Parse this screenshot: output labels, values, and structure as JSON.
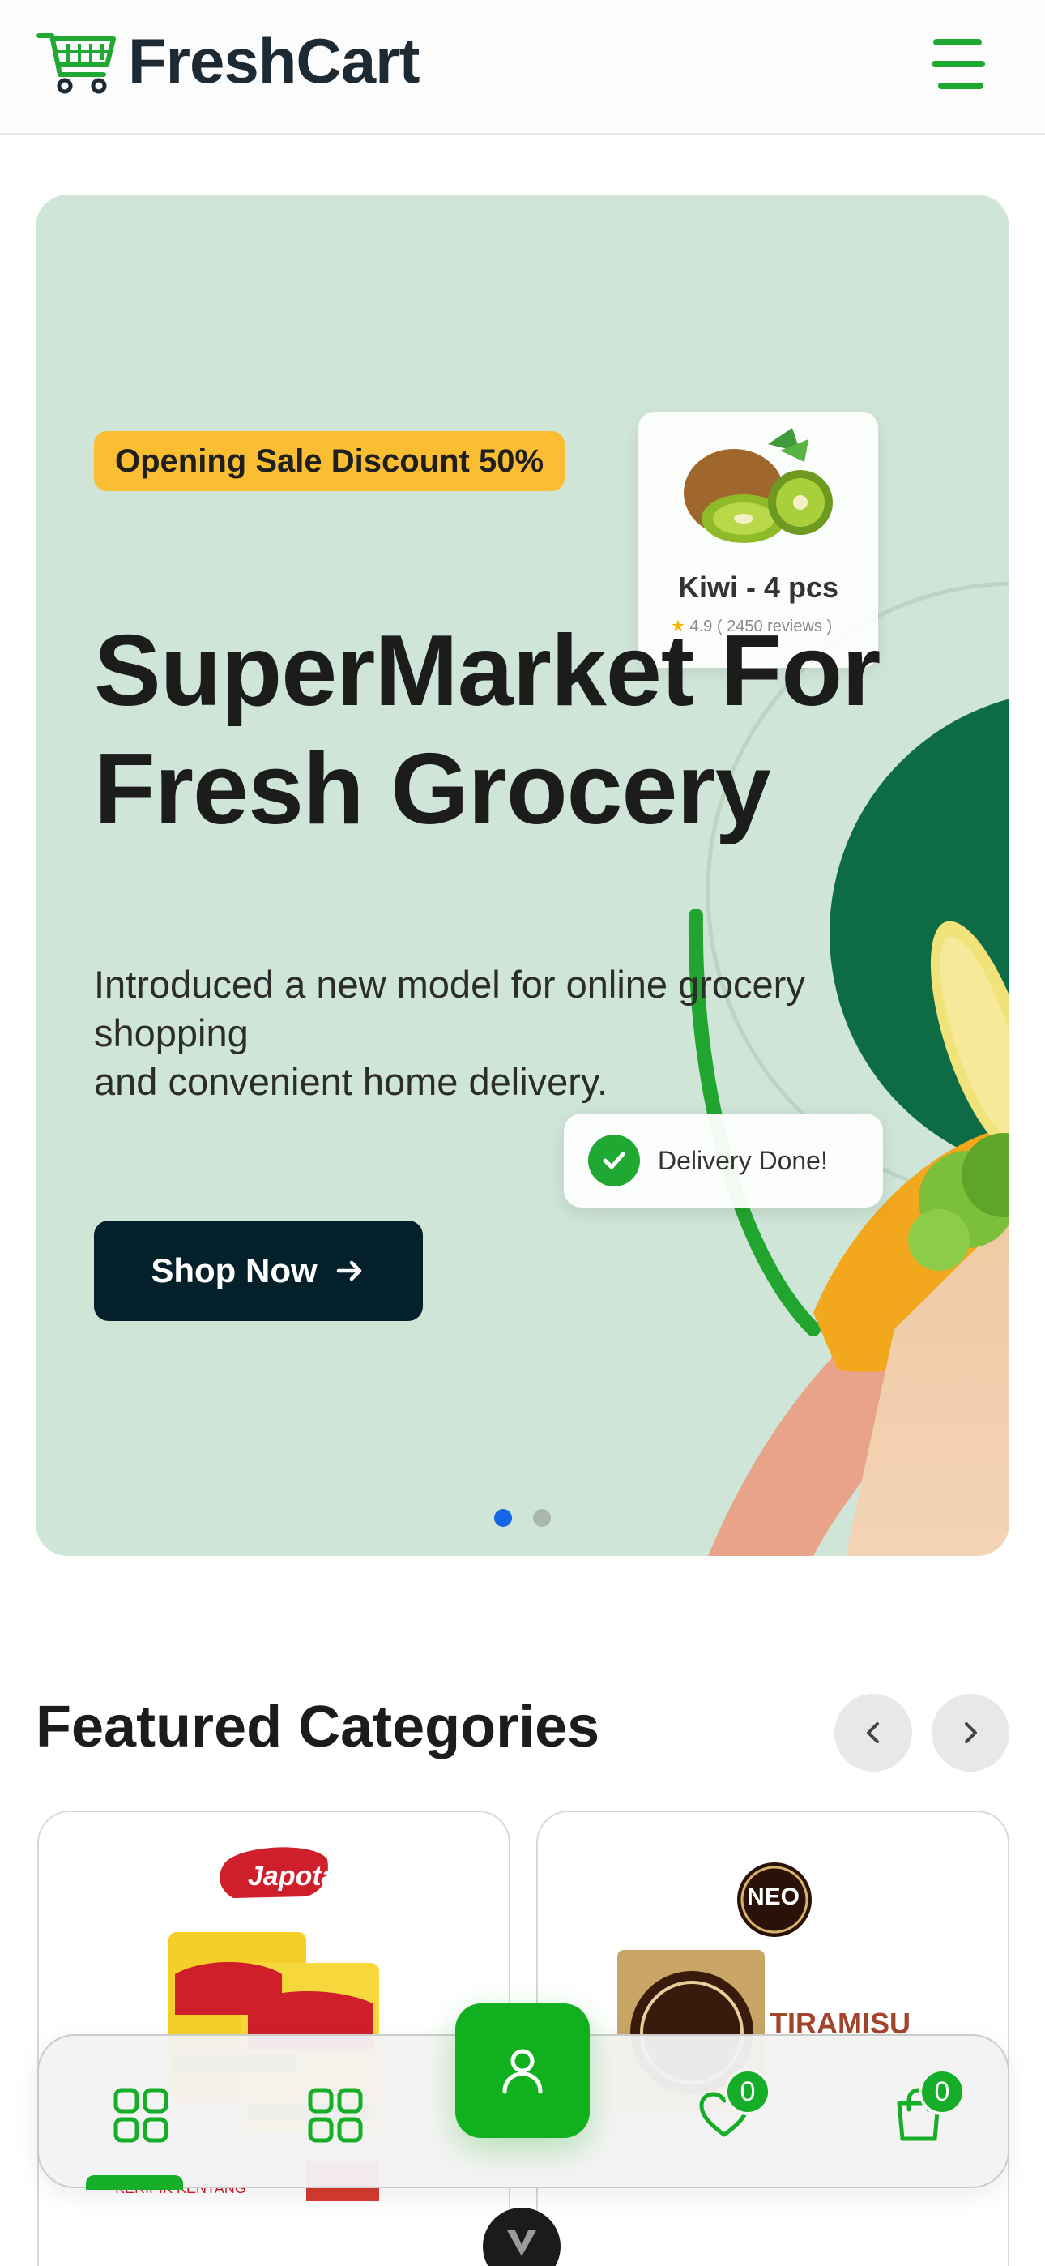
{
  "header": {
    "brand": "FreshCart",
    "logo_icon": "cart-icon",
    "menu_icon": "hamburger-menu-icon"
  },
  "hero": {
    "badge": "Opening Sale Discount 50%",
    "title_lines": [
      "SuperMarket For",
      "Fresh Grocery"
    ],
    "description_lines": [
      "Introduced a new model for online grocery",
      "shopping",
      "and convenient home delivery."
    ],
    "cta_label": "Shop Now",
    "cta_icon": "arrow-right-icon",
    "product_card": {
      "name": "Kiwi - 4 pcs",
      "rating": "4.9",
      "reviews": "( 2450 reviews )"
    },
    "delivery_card": {
      "label": "Delivery Done!"
    },
    "slides_total": 2,
    "slide_active": 1
  },
  "featured": {
    "title": "Featured Categories",
    "prev_icon": "chevron-left-icon",
    "next_icon": "chevron-right-icon",
    "cards": [
      {
        "brand": "Japota",
        "label": "KERIPIK KENTANG"
      },
      {
        "brand": "NEO",
        "label": "TIRAMISU"
      }
    ]
  },
  "bottom_nav": {
    "items": [
      {
        "icon": "grid-icon"
      },
      {
        "icon": "grid-icon"
      },
      {
        "icon": "user-icon"
      },
      {
        "icon": "heart-icon",
        "badge": "0"
      },
      {
        "icon": "shopping-bag-icon",
        "badge": "0"
      }
    ]
  },
  "colors": {
    "brand_green": "#16ad29",
    "hero_bg": "#cfe5d7",
    "badge_yellow": "#fbbd32",
    "cta_dark": "#04202a",
    "slider_active": "#1366e8"
  }
}
